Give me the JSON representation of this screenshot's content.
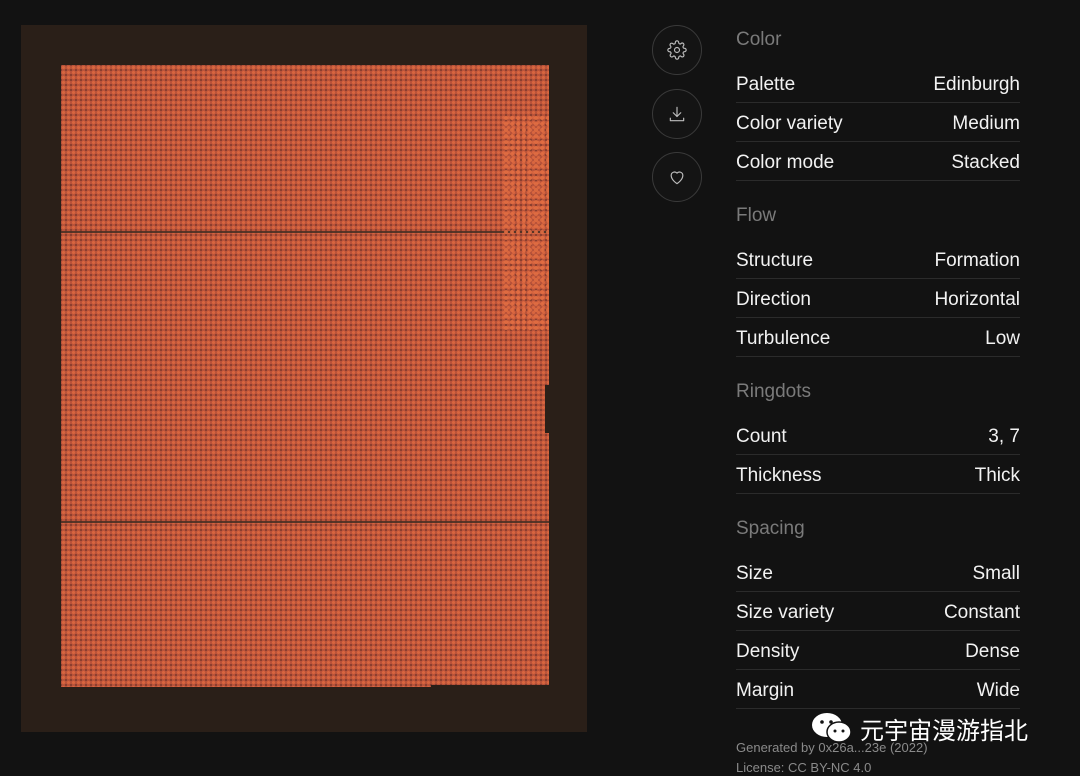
{
  "artwork": {
    "palette_colors": [
      "#2a1f18",
      "#b9533a",
      "#d8663f",
      "#7c3a2b"
    ]
  },
  "actions": {
    "settings": "gear-icon",
    "download": "download-icon",
    "favorite": "heart-icon"
  },
  "groups": [
    {
      "title": "Color",
      "rows": [
        {
          "label": "Palette",
          "value": "Edinburgh"
        },
        {
          "label": "Color variety",
          "value": "Medium"
        },
        {
          "label": "Color mode",
          "value": "Stacked"
        }
      ]
    },
    {
      "title": "Flow",
      "rows": [
        {
          "label": "Structure",
          "value": "Formation"
        },
        {
          "label": "Direction",
          "value": "Horizontal"
        },
        {
          "label": "Turbulence",
          "value": "Low"
        }
      ]
    },
    {
      "title": "Ringdots",
      "rows": [
        {
          "label": "Count",
          "value": "3, 7"
        },
        {
          "label": "Thickness",
          "value": "Thick"
        }
      ]
    },
    {
      "title": "Spacing",
      "rows": [
        {
          "label": "Size",
          "value": "Small"
        },
        {
          "label": "Size variety",
          "value": "Constant"
        },
        {
          "label": "Density",
          "value": "Dense"
        },
        {
          "label": "Margin",
          "value": "Wide"
        }
      ]
    }
  ],
  "meta": {
    "generated": "Generated by 0x26a...23e (2022)",
    "license": "License: CC BY-NC 4.0"
  },
  "watermark": {
    "text": "元宇宙漫游指北"
  }
}
